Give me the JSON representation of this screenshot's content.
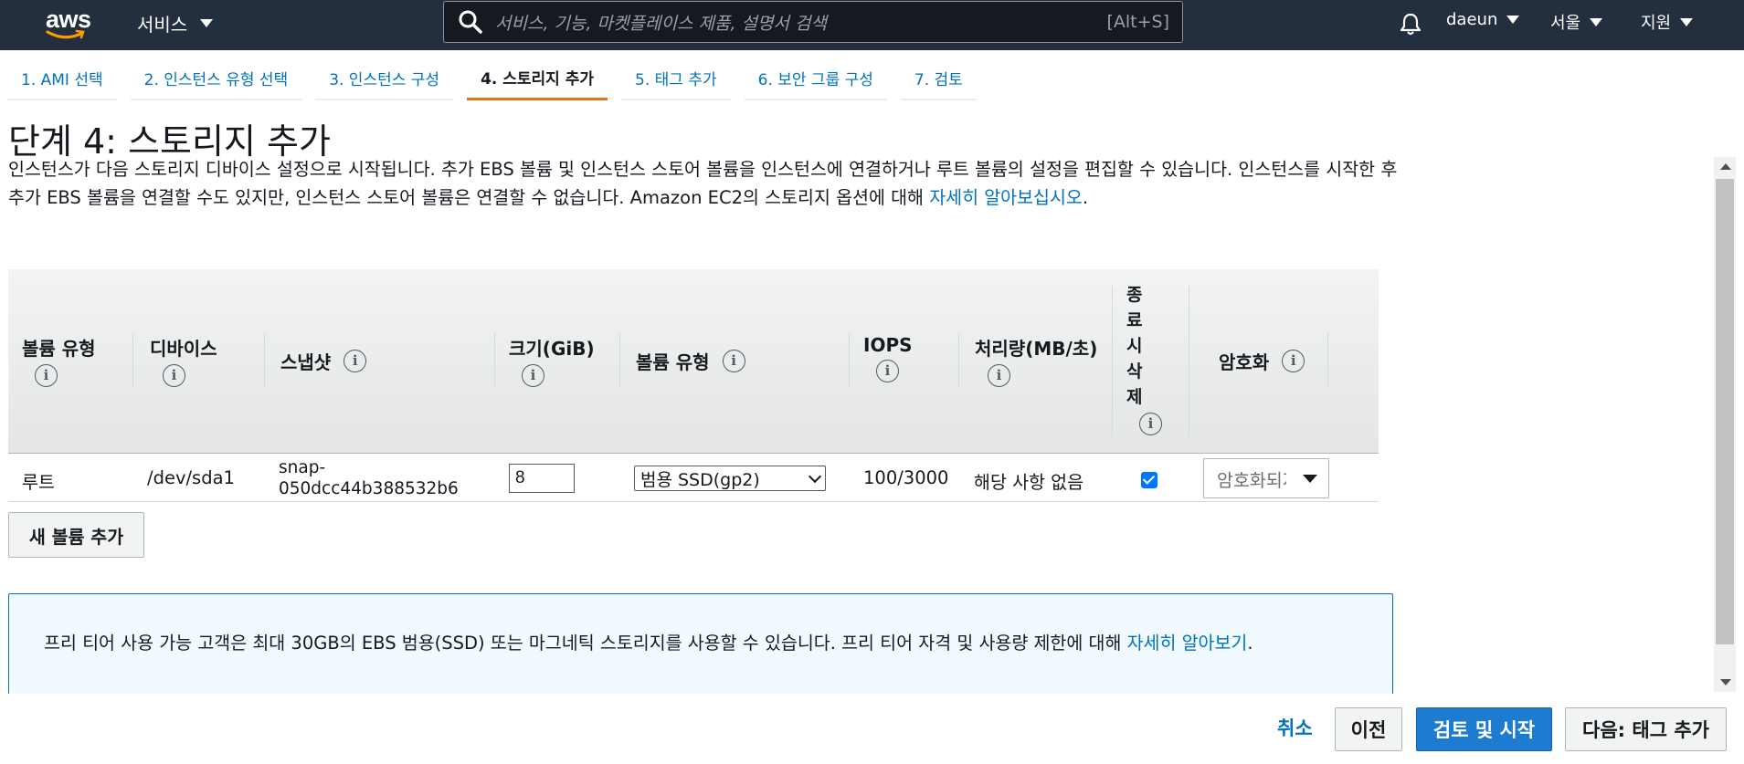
{
  "topnav": {
    "logo_text": "aws",
    "services_label": "서비스",
    "search_placeholder": "서비스, 기능, 마켓플레이스 제품, 설명서 검색",
    "search_shortcut": "[Alt+S]",
    "user": "daeun",
    "region": "서울",
    "support": "지원"
  },
  "tabs": [
    {
      "label": "1. AMI 선택",
      "active": false
    },
    {
      "label": "2. 인스턴스 유형 선택",
      "active": false
    },
    {
      "label": "3. 인스턴스 구성",
      "active": false
    },
    {
      "label": "4. 스토리지 추가",
      "active": true
    },
    {
      "label": "5. 태그 추가",
      "active": false
    },
    {
      "label": "6. 보안 그룹 구성",
      "active": false
    },
    {
      "label": "7. 검토",
      "active": false
    }
  ],
  "page": {
    "title": "단계 4: 스토리지 추가",
    "description": "인스턴스가 다음 스토리지 디바이스 설정으로 시작됩니다. 추가 EBS 볼륨 및 인스턴스 스토어 볼륨을 인스턴스에 연결하거나 루트 볼륨의 설정을 편집할 수 있습니다. 인스턴스를 시작한 후 추가 EBS 볼륨을 연결할 수도 있지만, 인스턴스 스토어 볼륨은 연결할 수 없습니다. Amazon EC2의 스토리지 옵션에 대해 ",
    "description_link": "자세히 알아보십시오",
    "description_end": "."
  },
  "table": {
    "headers": {
      "volume_type": "볼륨 유형",
      "device": "디바이스",
      "snapshot": "스냅샷",
      "size": "크기(GiB)",
      "ebs_volume_type": "볼륨 유형",
      "iops": "IOPS",
      "throughput": "처리량(MB/초)",
      "delete_on_termination": "종료시삭제",
      "encryption": "암호화"
    },
    "rows": [
      {
        "volume_type": "루트",
        "device": "/dev/sda1",
        "snapshot_line1": "snap-",
        "snapshot_line2": "050dcc44b388532b6",
        "size": "8",
        "ebs_volume_type": "범용 SSD(gp2)",
        "iops": "100/3000",
        "throughput": "해당 사항 없음",
        "delete_on_termination": true,
        "encryption": "암호화되지 않음"
      }
    ]
  },
  "add_volume_button": "새 볼륨 추가",
  "notice": {
    "text": "프리 티어 사용 가능 고객은 최대 30GB의 EBS 범용(SSD) 또는 마그네틱 스토리지를 사용할 수 있습니다. 프리 티어 자격 및 사용량 제한에 대해 ",
    "link": "자세히 알아보기",
    "end": "."
  },
  "footer": {
    "cancel": "취소",
    "previous": "이전",
    "review_launch": "검토 및 시작",
    "next": "다음: 태그 추가"
  },
  "colors": {
    "nav_bg": "#232f3e",
    "link": "#0073bb",
    "active_tab": "#ec7211",
    "primary_button": "#1d7bd0"
  }
}
